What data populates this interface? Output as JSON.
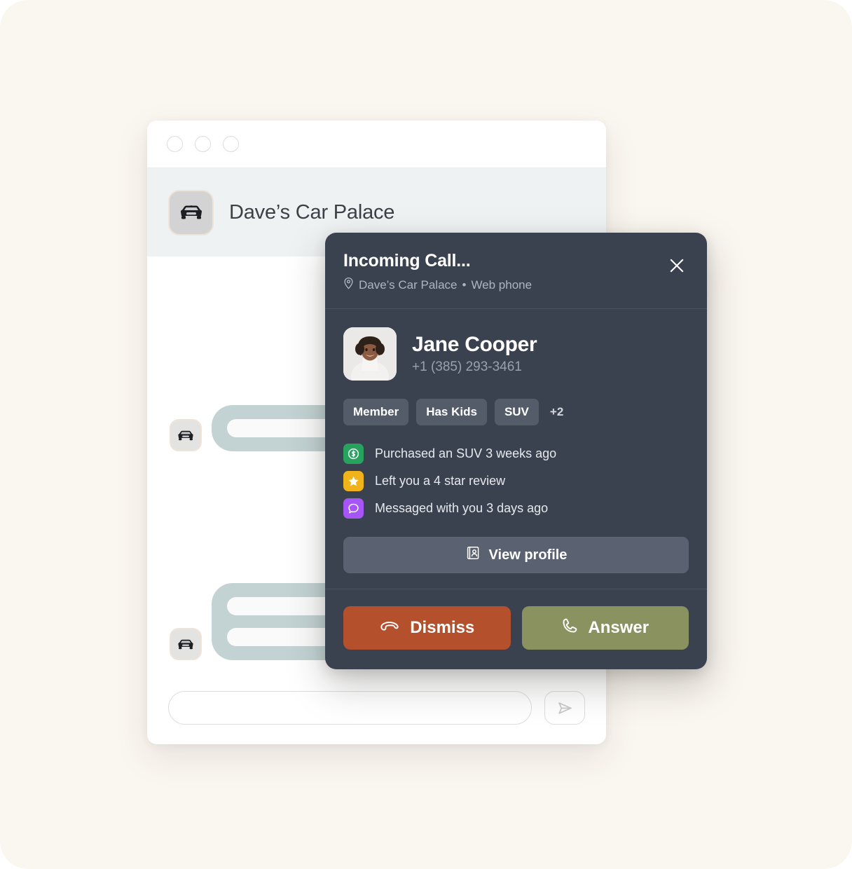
{
  "theme": {
    "page_background": "#faf6f0",
    "modal_background": "#3b424f",
    "chip_background": "#545c6a",
    "bubble_color": "#c3d3d3",
    "dismiss_color": "#b4502c",
    "answer_color": "#8a9360",
    "accent_green": "#27a35f",
    "accent_amber": "#f0b319",
    "accent_purple": "#a855f7"
  },
  "window": {
    "traffic_lights": [
      "close-dot",
      "minimize-dot",
      "zoom-dot"
    ],
    "business_name": "Dave’s Car Palace",
    "business_icon": "car-icon"
  },
  "chat": {
    "avatar_icon": "car-icon",
    "messages": [
      {
        "lines": 3,
        "widths": [
          170,
          170,
          170
        ]
      },
      {
        "lines": 1,
        "widths": [
          260
        ]
      },
      {
        "lines": 3,
        "widths": [
          200,
          200,
          200
        ]
      },
      {
        "lines": 2,
        "widths": [
          230,
          230
        ]
      }
    ]
  },
  "composer": {
    "input_value": "",
    "input_placeholder": "",
    "send_icon": "send-icon"
  },
  "modal": {
    "title": "Incoming Call...",
    "location_icon": "map-pin-icon",
    "location": "Dave’s Car Palace",
    "separator": "•",
    "channel": "Web phone",
    "close_icon": "close-icon",
    "contact": {
      "avatar": "contact-photo",
      "name": "Jane Cooper",
      "phone": "+1 (385) 293-3461"
    },
    "tags": [
      "Member",
      "Has Kids",
      "SUV"
    ],
    "tags_more": "+2",
    "activity": [
      {
        "icon": "dollar-circle-icon",
        "color": "#27a35f",
        "text": "Purchased an SUV 3 weeks ago"
      },
      {
        "icon": "star-icon",
        "color": "#f0b319",
        "text": "Left you a 4 star review"
      },
      {
        "icon": "chat-bubble-icon",
        "color": "#a855f7",
        "text": "Messaged with you 3 days ago"
      }
    ],
    "view_profile": {
      "icon": "contact-card-icon",
      "label": "View profile"
    },
    "actions": [
      {
        "icon": "phone-hangup-icon",
        "label": "Dismiss",
        "color": "#b4502c"
      },
      {
        "icon": "phone-icon",
        "label": "Answer",
        "color": "#8a9360"
      }
    ]
  }
}
